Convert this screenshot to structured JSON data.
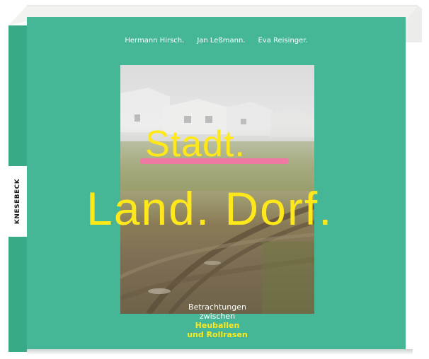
{
  "book": {
    "authors": [
      "Hermann Hirsch.",
      "Jan Leßmann.",
      "Eva Reisinger."
    ],
    "publisher_spine": "KNESEBECK",
    "title_struck": "Stadt.",
    "title": "Land. Dorf.",
    "subtitle": {
      "line1": "Betrachtungen",
      "line2": "zwischen",
      "line3": "Heuballen",
      "line4": "und Rollrasen"
    },
    "colors": {
      "cover": "#45b796",
      "title": "#ffe81a",
      "strike": "#ee7aa4"
    }
  }
}
